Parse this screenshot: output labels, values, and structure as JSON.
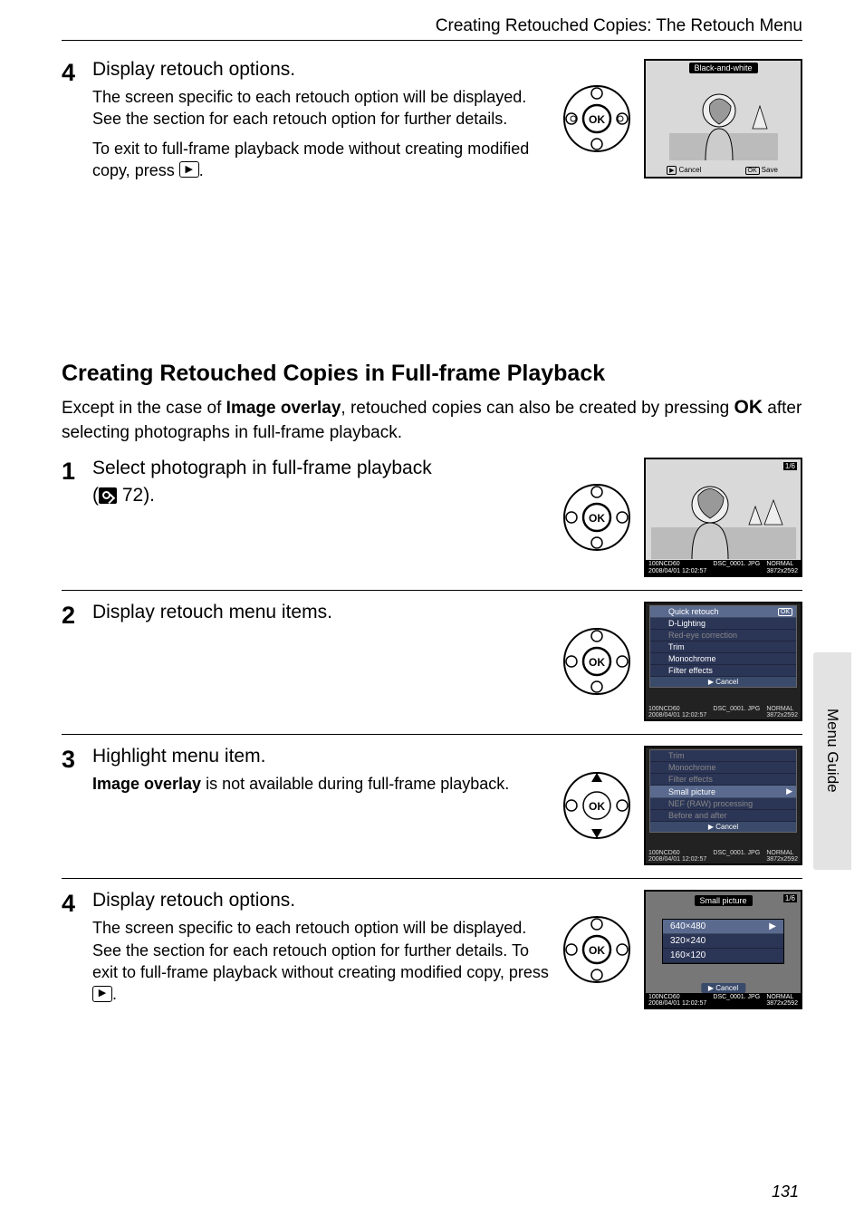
{
  "header": "Creating Retouched Copies: The Retouch Menu",
  "top_step": {
    "num": "4",
    "title": "Display retouch options.",
    "p1": "The screen specific to each retouch option will be displayed. See the section for each retouch option for further details.",
    "p2a": "To exit to full-frame playback mode without creating modified copy, press ",
    "p2b": "."
  },
  "top_screen": {
    "label": "Black-and-white",
    "cancel": "Cancel",
    "save": "Save",
    "ok": "OK"
  },
  "section": {
    "title": "Creating Retouched Copies in Full-frame Playback",
    "para_a": "Except in the case of ",
    "para_b": "Image overlay",
    "para_c": ", retouched copies can also be created by pressing ",
    "para_d": " after selecting photographs in full-frame playback.",
    "ok_label": "OK"
  },
  "steps": [
    {
      "num": "1",
      "title": "Select photograph in full-frame playback",
      "ref_a": "(",
      "ref_b": " 72).",
      "screen": {
        "counter": "1/6",
        "info1": "100NCD60",
        "info2": "DSC_0001. JPG",
        "info3": "2008/04/01 12:02:57",
        "info4": "NORMAL",
        "info5": "3872x2592"
      }
    },
    {
      "num": "2",
      "title": "Display retouch menu items.",
      "menu": {
        "items": [
          {
            "label": "Quick retouch",
            "hl": true,
            "ok": true
          },
          {
            "label": "D-Lighting"
          },
          {
            "label": "Red-eye correction",
            "dim": true
          },
          {
            "label": "Trim"
          },
          {
            "label": "Monochrome"
          },
          {
            "label": "Filter effects"
          }
        ],
        "cancel": "Cancel",
        "info1": "100NCD60",
        "info2": "DSC_0001. JPG",
        "info3": "2008/04/01 12:02:57",
        "info4": "NORMAL",
        "info5": "3872x2592"
      }
    },
    {
      "num": "3",
      "title": "Highlight menu item.",
      "desc_a": "Image overlay",
      "desc_b": " is not available during full-frame playback.",
      "menu": {
        "items": [
          {
            "label": "Trim",
            "dim": true
          },
          {
            "label": "Monochrome",
            "dim": true
          },
          {
            "label": "Filter effects",
            "dim": true
          },
          {
            "label": "Small picture",
            "hl": true,
            "arrow": true
          },
          {
            "label": "NEF (RAW) processing",
            "dim": true
          },
          {
            "label": "Before and after",
            "dim": true
          }
        ],
        "cancel": "Cancel",
        "info1": "100NCD60",
        "info2": "DSC_0001. JPG",
        "info3": "2008/04/01 12:02:57",
        "info4": "NORMAL",
        "info5": "3872x2592"
      }
    },
    {
      "num": "4",
      "title": "Display retouch options.",
      "desc": "The screen specific to each retouch option will be displayed. See the section for each retouch option for further details. To exit to full-frame playback without creating modified copy, press ",
      "desc_end": ".",
      "sizes": {
        "label": "Small picture",
        "counter": "1/6",
        "rows": [
          "640×480",
          "320×240",
          "160×120"
        ],
        "cancel": "Cancel",
        "info1": "100NCD60",
        "info2": "DSC_0001. JPG",
        "info3": "2008/04/01 12:02:57",
        "info4": "NORMAL",
        "info5": "3872x2592"
      }
    }
  ],
  "dpad_ok": "OK",
  "side_tab": "Menu Guide",
  "page_num": "131"
}
